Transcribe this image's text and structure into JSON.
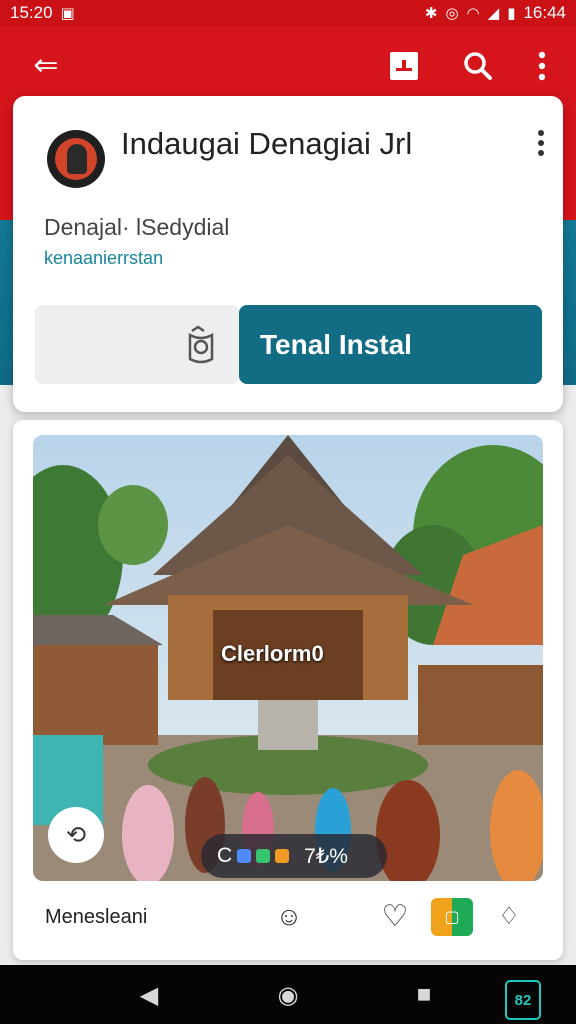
{
  "status_bar": {
    "time_left": "15:20",
    "time_right": "16:44",
    "icons": [
      "image-icon",
      "bluetooth-icon",
      "alarm-icon",
      "wifi-icon",
      "signal-icon",
      "battery-icon"
    ]
  },
  "app_bar": {
    "back_icon": "arrow-back-icon",
    "actions": [
      "bookmark-icon",
      "search-icon",
      "more-vert-icon"
    ]
  },
  "app_card": {
    "title": "Indaugai Denagiai Jrl",
    "developer": "Denajal· lSedydial",
    "category": "kenaanierrstan",
    "install_label": "Tenal Instal"
  },
  "photo_card": {
    "overlay_label": "Clerlorm0",
    "counter_text": "7₺%",
    "footer_label": "Menesleani"
  },
  "colors": {
    "primary_red": "#d5141b",
    "teal": "#116c84",
    "accent_teal": "#17869b"
  }
}
